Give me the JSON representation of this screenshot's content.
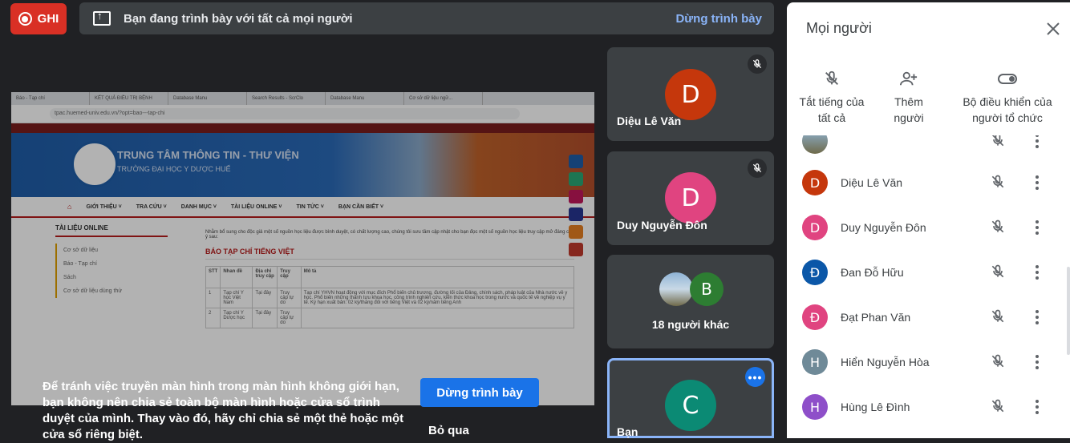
{
  "record": {
    "label": "GHI"
  },
  "presenting_bar": {
    "message": "Bạn đang trình bày với tất cả mọi người",
    "stop_label": "Dừng trình bày"
  },
  "shared_screen": {
    "tabs": [
      "Báo - Tạp chí",
      "KẾT QUẢ ĐIỀU TRỊ BỆNH",
      "Database Manu",
      "Search Results - ScrClo",
      "Database Manu",
      "Cơ sở dữ liệu ngữ..."
    ],
    "url": "tpac.huemed-univ.edu.vn/?opt=bao---tap-chi",
    "site_title": "TRUNG TÂM THÔNG TIN - THƯ VIỆN",
    "site_subtitle": "TRƯỜNG ĐẠI HỌC Y DƯỢC HUẾ",
    "nav": [
      "GIỚI THIỆU ˅",
      "TRA CỨU ˅",
      "DANH MỤC ˅",
      "TÀI LIỆU ONLINE ˅",
      "TIN TỨC ˅",
      "BẠN CẦN BIẾT ˅"
    ],
    "sidebar_heading": "TÀI LIỆU ONLINE",
    "sidebar_items": [
      "Cơ sở dữ liệu",
      "Báo - Tạp chí",
      "Sách",
      "Cơ sở dữ liệu dùng thử"
    ],
    "intro": "Nhằm bổ sung cho độc giả một số nguồn học liệu được bình duyệt, có chất lượng cao, chúng tôi sưu tầm cập nhật cho bạn đọc một số nguồn học liệu truy cập mở đáng chú ý sau:",
    "section_heading": "BÁO TẠP CHÍ TIẾNG VIỆT",
    "table_headers": [
      "STT",
      "Nhan đề",
      "Địa chỉ truy cập",
      "Truy cập",
      "Mô tả"
    ],
    "table_rows": [
      [
        "1",
        "Tạp chí Y học Việt Nam",
        "Tại đây",
        "Truy cập tự do",
        "Tạp chí YHVN hoạt động với mục đích Phổ biến chủ trương, đường lối của Đảng, chính sách, pháp luật của Nhà nước về y học. Phổ biến những thành tựu khoa học, công trình nghiên cứu, kiến thức khoa học trong nước và quốc tế về nghiệp vụ y tế. Kỳ hạn xuất bản: 02 kỳ/tháng đối với tiếng Việt và 02 kỳ/năm tiếng Anh"
      ],
      [
        "2",
        "Tạp chí Y Dược học",
        "Tại đây",
        "Truy cập tự do",
        ""
      ]
    ]
  },
  "share_warning": {
    "text": "Để tránh việc truyền màn hình trong màn hình không giới hạn, bạn không nên chia sẻ toàn bộ màn hình hoặc cửa sổ trình duyệt của mình. Thay vào đó, hãy chỉ chia sẻ một thẻ hoặc một cửa sổ riêng biệt.",
    "stop_label": "Dừng trình bày",
    "skip_label": "Bỏ qua"
  },
  "tiles": [
    {
      "name": "Diệu Lê Văn",
      "initial": "D",
      "color": "#c5370c",
      "muted": true
    },
    {
      "name": "Duy Nguyễn Đôn",
      "initial": "D",
      "color": "#e04480",
      "muted": true
    },
    {
      "name": "18 người khác",
      "initial": "B",
      "color": "#2d7d32"
    },
    {
      "name": "Bạn",
      "initial": "C",
      "color": "#0b8a74"
    }
  ],
  "people_panel": {
    "title": "Mọi người",
    "actions": [
      {
        "label": "Tắt tiếng của tất cả",
        "icon": "mic-off-icon"
      },
      {
        "label": "Thêm người",
        "icon": "person-add-icon"
      },
      {
        "label": "Bộ điều khiển của người tổ chức",
        "icon": "toggle-icon"
      }
    ],
    "participants": [
      {
        "name": "Diệu Lê Văn",
        "initial": "D",
        "color": "#c5370c"
      },
      {
        "name": "Duy Nguyễn Đôn",
        "initial": "D",
        "color": "#e04480"
      },
      {
        "name": "Đan Đỗ Hữu",
        "initial": "Đ",
        "color": "#0b57a8"
      },
      {
        "name": "Đạt Phan Văn",
        "initial": "Đ",
        "color": "#e04480"
      },
      {
        "name": "Hiển Nguyễn Hòa",
        "initial": "H",
        "color": "#6f8a98"
      },
      {
        "name": "Hùng Lê Đình",
        "initial": "H",
        "color": "#8e4fc9"
      }
    ]
  }
}
